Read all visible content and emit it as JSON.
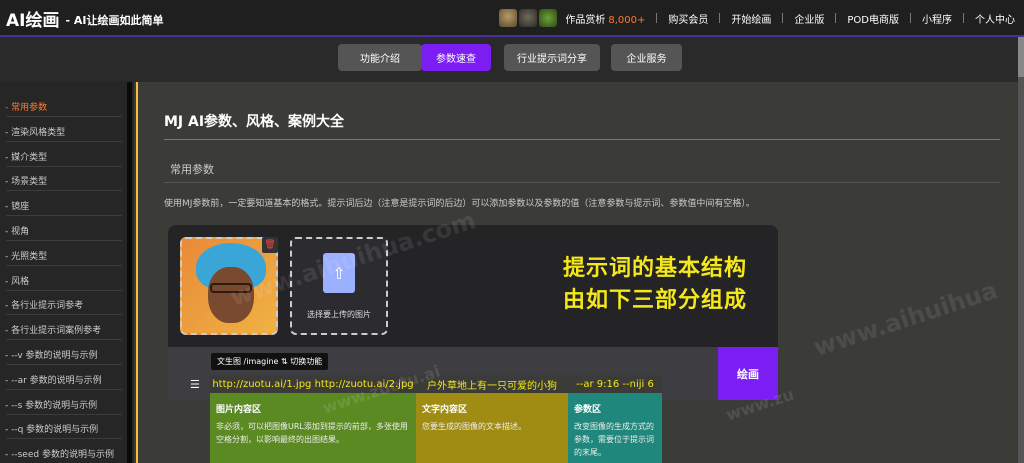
{
  "header": {
    "logo": "AI绘画",
    "slogan": "- AI让绘画如此简单",
    "works_label": "作品赏析",
    "works_count": "8,000+",
    "links": [
      "购买会员",
      "开始绘画",
      "企业版",
      "POD电商版",
      "小程序",
      "个人中心"
    ]
  },
  "subnav": {
    "tabs": [
      {
        "label": "功能介绍",
        "active": false
      },
      {
        "label": "参数速查",
        "active": true
      },
      {
        "label": "行业提示词分享",
        "active": false
      },
      {
        "label": "企业服务",
        "active": false
      }
    ]
  },
  "sidebar": {
    "items": [
      "- 常用参数",
      "- 渲染风格类型",
      "- 媒介类型",
      "- 场景类型",
      "- 镜座",
      "- 视角",
      "- 光照类型",
      "- 风格",
      "- 各行业提示词参考",
      "- 各行业提示词案例参考",
      "- --v 参数的说明与示例",
      "- --ar 参数的说明与示例",
      "- --s 参数的说明与示例",
      "- --q 参数的说明与示例",
      "- --seed 参数的说明与示例"
    ],
    "active_index": 0
  },
  "main": {
    "title": "MJ AI参数、风格、案例大全",
    "section_title": "常用参数",
    "description": "使用MJ参数前，一定要知道基本的格式。提示词后边（注意是提示词的后边）可以添加参数以及参数的值（注意参数与提示词、参数值中间有空格）。"
  },
  "illustration": {
    "upload_text": "选择要上传的图片",
    "big_text_line1": "提示词的基本结构",
    "big_text_line2": "由如下三部分组成",
    "mode_chip": "文生图 /imagine ⇅ 切换功能",
    "submit_label": "绘画",
    "columns": [
      {
        "head": "http://zuotu.ai/1.jpg http://zuotu.ai/2.jpg",
        "title": "图片内容区",
        "text": "非必须，可以把图像URL添加到提示的前部，多张使用空格分割，以影响最终的出图结果。"
      },
      {
        "head": "户外草地上有一只可爱的小狗",
        "title": "文字内容区",
        "text": "您要生成的图像的文本描述。"
      },
      {
        "head": "--ar 9:16 --niji 6",
        "title": "参数区",
        "text": "改变图像的生成方式的参数，需要位于提示词的末尾。"
      }
    ]
  },
  "watermarks": {
    "main": "www.aihuihua.com",
    "right": "www.aihuihua",
    "small": "www.zuotu.ai",
    "bottom": "www.zu"
  }
}
